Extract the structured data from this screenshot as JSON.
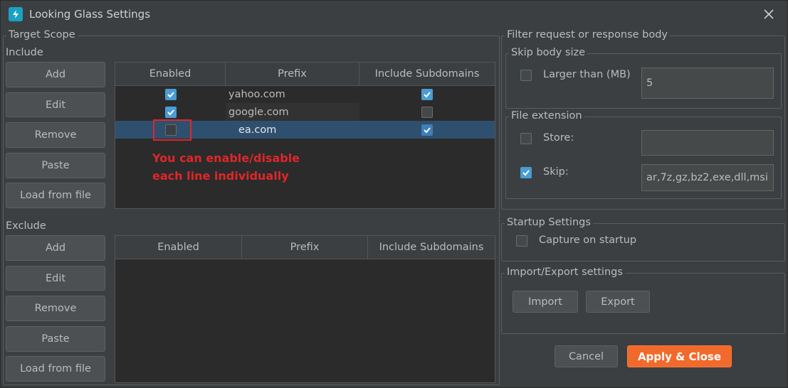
{
  "window": {
    "title": "Looking Glass Settings",
    "icon": "lightning-bolt-icon",
    "close": "close-icon"
  },
  "target_scope": {
    "title": "Target Scope",
    "include": {
      "label": "Include",
      "buttons": [
        "Add",
        "Edit",
        "Remove",
        "Paste",
        "Load from file"
      ],
      "columns": [
        "Enabled",
        "Prefix",
        "Include Subdomains"
      ],
      "rows": [
        {
          "enabled": true,
          "prefix": "yahoo.com",
          "subdomains": true
        },
        {
          "enabled": true,
          "prefix": "google.com",
          "subdomains": false
        },
        {
          "enabled": false,
          "prefix": "ea.com",
          "subdomains": true
        }
      ],
      "selected_row": 2
    },
    "exclude": {
      "label": "Exclude",
      "buttons": [
        "Add",
        "Edit",
        "Remove",
        "Paste",
        "Load from file"
      ],
      "columns": [
        "Enabled",
        "Prefix",
        "Include Subdomains"
      ],
      "rows": []
    }
  },
  "annotation": {
    "line1": "You can enable/disable",
    "line2": "each line individually",
    "color": "#e0262a"
  },
  "filter": {
    "title": "Filter request or response body",
    "skip_body_size": {
      "title": "Skip body size",
      "label": "Larger than (MB)",
      "checked": false,
      "value": "5"
    },
    "file_extension": {
      "title": "File extension",
      "store": {
        "label": "Store:",
        "checked": false,
        "value": ""
      },
      "skip": {
        "label": "Skip:",
        "checked": true,
        "value": "ar,7z,gz,bz2,exe,dll,msi"
      }
    }
  },
  "startup": {
    "title": "Startup Settings",
    "label": "Capture on startup",
    "checked": false
  },
  "import_export": {
    "title": "Import/Export settings",
    "import_label": "Import",
    "export_label": "Export"
  },
  "footer": {
    "cancel_label": "Cancel",
    "apply_label": "Apply & Close"
  },
  "colors": {
    "background": "#3c3f41",
    "accent": "#4a9cd6",
    "primary": "#f26a2b",
    "selection": "#2f4f6f"
  }
}
